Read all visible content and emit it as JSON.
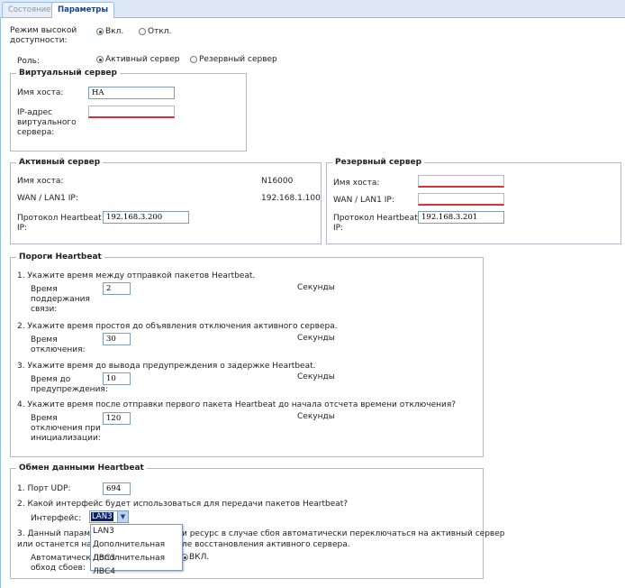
{
  "tabs": [
    "Состояние",
    "Параметры"
  ],
  "ha_mode": {
    "label": "Режим высокой доступности:",
    "on": "Вкл.",
    "off": "Откл."
  },
  "role": {
    "label": "Роль:",
    "active": "Активный сервер",
    "standby": "Резервный сервер"
  },
  "virtual_server": {
    "legend": "Виртуальный сервер",
    "hostname_label": "Имя хоста:",
    "hostname_value": "HA",
    "ip_label": "IP-адрес виртуального сервера:",
    "ip_value": ""
  },
  "active_server": {
    "legend": "Активный сервер",
    "hostname_label": "Имя хоста:",
    "hostname_value": "N16000",
    "wan_label": "WAN / LAN1 IP:",
    "wan_value": "192.168.1.100",
    "hb_label": "Протокол Heartbeat IP:",
    "hb_value": "192.168.3.200"
  },
  "standby_server": {
    "legend": "Резервный сервер",
    "hostname_label": "Имя хоста:",
    "hostname_value": "",
    "wan_label": "WAN / LAN1 IP:",
    "wan_value": "",
    "hb_label": "Протокол Heartbeat IP:",
    "hb_value": "192.168.3.201"
  },
  "thresholds": {
    "legend": "Пороги Heartbeat",
    "q1": "1. Укажите время между отправкой пакетов Heartbeat.",
    "keepalive_label": "Время поддержания связи:",
    "keepalive_value": "2",
    "q2": "2. Укажите время простоя до объявления отключения активного сервера.",
    "deadtime_label": "Время отключения:",
    "deadtime_value": "30",
    "q3": "3. Укажите время до вывода предупреждения о задержке Heartbeat.",
    "warn_label": "Время до предупреждения:",
    "warn_value": "10",
    "q4": "4. Укажите время после отправки первого пакета Heartbeat до начала отсчета времени отключения?",
    "init_label": "Время отключения при инициализации:",
    "init_value": "120",
    "unit": "Секунды"
  },
  "exchange": {
    "legend": "Обмен данными Heartbeat",
    "port_label": "1. Порт UDP:",
    "port_value": "694",
    "q2": "2. Какой интерфейс будет использоваться для передачи пакетов Heartbeat?",
    "interface_label": "Интерфейс:",
    "interface_value": "LAN3",
    "q3_line1_left": "3. Данный параме",
    "q3_line1_right": "и ресурс в случае сбоя автоматически переключаться на активный сервер",
    "q3_line2_left": "или останется на",
    "q3_line2_right": "ле восстановления активного сервера.",
    "failback_label": "Автоматически обход сбоев:",
    "failback_on": "ВКЛ.",
    "options": [
      "LAN3",
      "Дополнительная ЛВС3",
      "Дополнительная ЛВС4"
    ]
  }
}
